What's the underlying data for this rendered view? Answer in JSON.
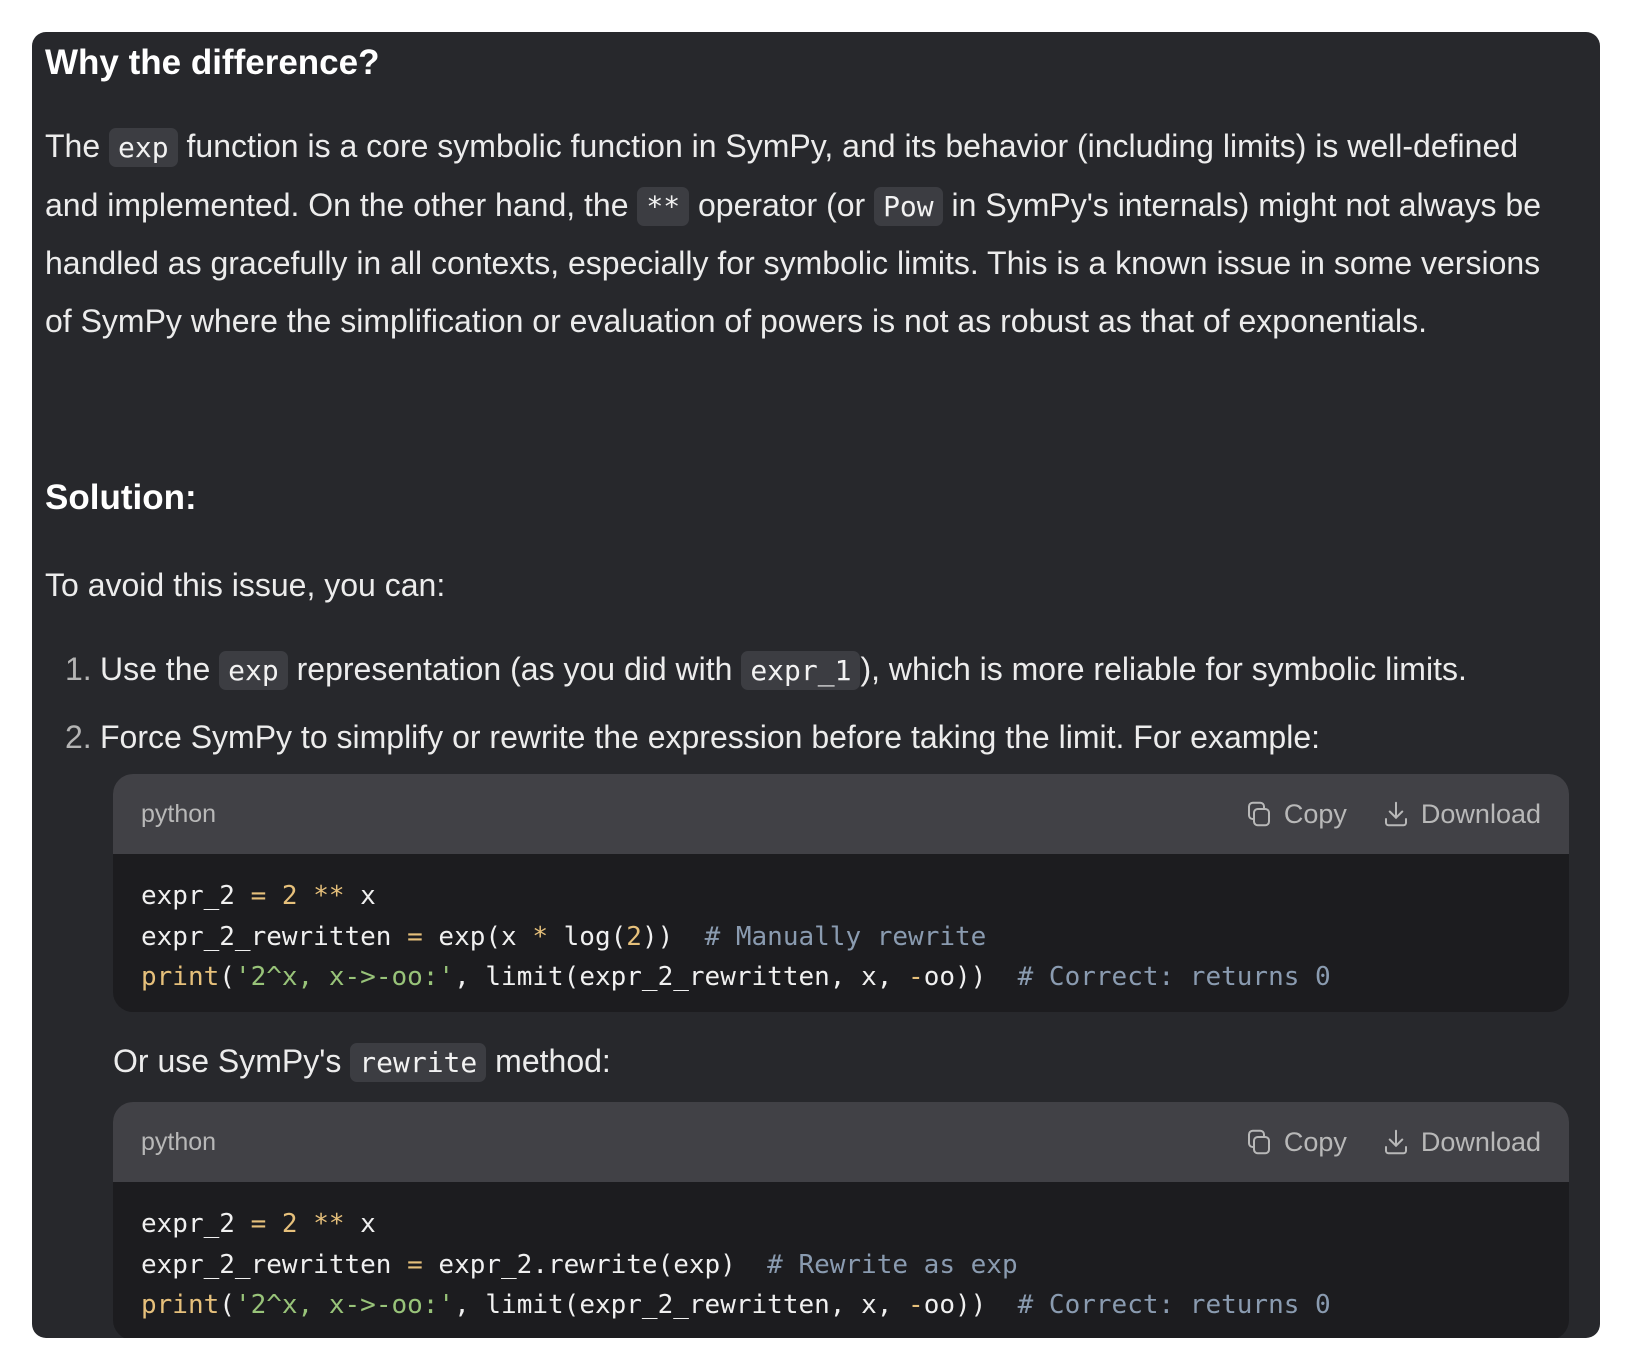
{
  "section1": {
    "heading": "Why the difference?",
    "para": {
      "t1": "The ",
      "c1": "exp",
      "t2": " function is a core symbolic function in SymPy, and its behavior (including limits) is well-defined and implemented. On the other hand, the ",
      "c2": "**",
      "t3": " operator (or ",
      "c3": "Pow",
      "t4": " in SymPy's internals) might not always be handled as gracefully in all contexts, especially for symbolic limits. This is a known issue in some versions of SymPy where the simplification or evaluation of powers is not as robust as that of exponentials."
    }
  },
  "section2": {
    "heading": "Solution:",
    "intro": "To avoid this issue, you can:"
  },
  "list": {
    "item1": {
      "num": "1.",
      "t1": "Use the ",
      "c1": "exp",
      "t2": " representation (as you did with ",
      "c2": "expr_1",
      "t3": "), which is more reliable for symbolic limits."
    },
    "item2": {
      "num": "2.",
      "text": "Force SymPy to simplify or rewrite the expression before taking the limit. For example:"
    }
  },
  "code_blocks": [
    {
      "lang": "python",
      "copy_label": "Copy",
      "download_label": "Download",
      "lines": [
        {
          "a": "expr_2 ",
          "b": "=",
          "c": " ",
          "d": "2",
          "e": " ",
          "f": "**",
          "g": " x"
        },
        {
          "a": "expr_2_rewritten ",
          "b": "=",
          "c": " exp(x ",
          "d": "*",
          "e": " log(",
          "f": "2",
          "g": "))  ",
          "h": "# Manually rewrite"
        },
        {
          "a": "print",
          "b": "(",
          "c": "'2^x, x->-oo:'",
          "d": ", limit(expr_2_rewritten, x, ",
          "e": "-",
          "f": "oo))  ",
          "g": "# Correct: returns 0"
        }
      ]
    },
    {
      "lang": "python",
      "copy_label": "Copy",
      "download_label": "Download",
      "lines": [
        {
          "a": "expr_2 ",
          "b": "=",
          "c": " ",
          "d": "2",
          "e": " ",
          "f": "**",
          "g": " x"
        },
        {
          "a": "expr_2_rewritten ",
          "b": "=",
          "c": " expr_2.rewrite(exp)  ",
          "d": "# Rewrite as exp"
        },
        {
          "a": "print",
          "b": "(",
          "c": "'2^x, x->-oo:'",
          "d": ", limit(expr_2_rewritten, x, ",
          "e": "-",
          "f": "oo))  ",
          "g": "# Correct: returns 0"
        }
      ]
    }
  ],
  "between": {
    "t1": "Or use SymPy's ",
    "c1": "rewrite",
    "t2": " method:"
  },
  "icons": {
    "copy": "copy-icon",
    "download": "download-icon"
  }
}
